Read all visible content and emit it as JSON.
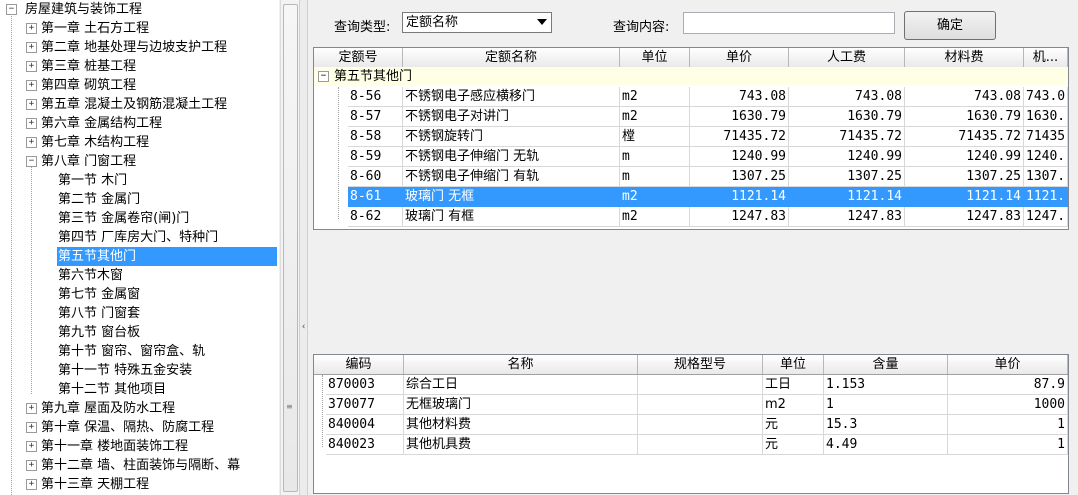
{
  "tree": {
    "root": "房屋建筑与装饰工程",
    "chapters_before": [
      "第一章  土石方工程",
      "第二章  地基处理与边坡支护工程",
      "第三章  桩基工程",
      "第四章  砌筑工程",
      "第五章  混凝土及钢筋混凝土工程",
      "第六章  金属结构工程",
      "第七章  木结构工程"
    ],
    "chapter8": "第八章  门窗工程",
    "sections": [
      "第一节  木门",
      "第二节  金属门",
      "第三节  金属卷帘(闸)门",
      "第四节  厂库房大门、特种门",
      "第五节其他门",
      "第六节木窗",
      "第七节  金属窗",
      "第八节  门窗套",
      "第九节  窗台板",
      "第十节  窗帘、窗帘盒、轨",
      "第十一节  特殊五金安装",
      "第十二节  其他项目"
    ],
    "selected_section": 4,
    "chapters_after": [
      "第九章  屋面及防水工程",
      "第十章  保温、隔热、防腐工程",
      "第十一章  楼地面装饰工程",
      "第十二章  墙、柱面装饰与隔断、幕",
      "第十三章  天棚工程"
    ],
    "expand_glyph": "+",
    "collapse_glyph": "−"
  },
  "query": {
    "type_label": "查询类型:",
    "type_value": "定额名称",
    "content_label": "查询内容:",
    "content_value": "",
    "ok_label": "确定"
  },
  "quota_grid": {
    "headers": [
      "定额号",
      "定额名称",
      "单位",
      "单价",
      "人工费",
      "材料费",
      "机..."
    ],
    "group": "第五节其他门",
    "selected_row": 5,
    "rows": [
      [
        "8-56",
        "不锈钢电子感应横移门",
        "m2",
        "743.08",
        "743.08",
        "743.08",
        "743.0"
      ],
      [
        "8-57",
        "不锈钢电子对讲门",
        "m2",
        "1630.79",
        "1630.79",
        "1630.79",
        "1630."
      ],
      [
        "8-58",
        "不锈钢旋转门",
        "樘",
        "71435.72",
        "71435.72",
        "71435.72",
        "71435"
      ],
      [
        "8-59",
        "不锈钢电子伸缩门 无轨",
        "m",
        "1240.99",
        "1240.99",
        "1240.99",
        "1240."
      ],
      [
        "8-60",
        "不锈钢电子伸缩门 有轨",
        "m",
        "1307.25",
        "1307.25",
        "1307.25",
        "1307."
      ],
      [
        "8-61",
        "玻璃门 无框",
        "m2",
        "1121.14",
        "1121.14",
        "1121.14",
        "1121."
      ],
      [
        "8-62",
        "玻璃门 有框",
        "m2",
        "1247.83",
        "1247.83",
        "1247.83",
        "1247."
      ]
    ]
  },
  "material_grid": {
    "headers": [
      "编码",
      "名称",
      "规格型号",
      "单位",
      "含量",
      "单价"
    ],
    "rows": [
      [
        "870003",
        "综合工日",
        "",
        "工日",
        "1.153",
        "87.9"
      ],
      [
        "370077",
        "无框玻璃门",
        "",
        "m2",
        "1",
        "1000"
      ],
      [
        "840004",
        "其他材料费",
        "",
        "元",
        "15.3",
        "1"
      ],
      [
        "840023",
        "其他机具费",
        "",
        "元",
        "4.49",
        "1"
      ]
    ]
  },
  "colors": {
    "selection": "#3399ff",
    "group_row_bg": "#ffffe6"
  }
}
